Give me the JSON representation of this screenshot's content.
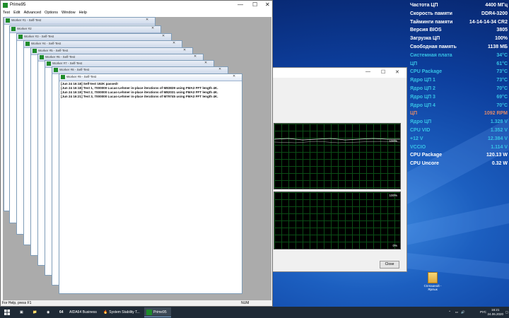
{
  "app": {
    "title": "Prime95",
    "menu": [
      "Test",
      "Edit",
      "Advanced",
      "Options",
      "Window",
      "Help"
    ],
    "status_text": "For Help, press F1",
    "num_indicator": "NUM"
  },
  "workers": [
    "Worker #1 - Self-Test",
    "Worker #2",
    "Worker #3 - Self-Test",
    "Worker #4 - Self-Test",
    "Worker #5 - Self-Test",
    "Worker #6 - Self-Test",
    "Worker #7 - Self-Test",
    "Worker #8 - Self-Test",
    "Worker #9 - Self-Test"
  ],
  "front_worker": {
    "title": "Worker #9 - Self-Test",
    "log": [
      "[Jun 24 16:18] Self-test 192K passed!",
      "[Jun 24 16:18] Test 1, 7000000 Lucas-Lehmer in-place iterations of M83839 using FMA3 FFT length 4K.",
      "[Jun 24 16:19] Test 2, 7000000 Lucas-Lehmer in-place iterations of M82031 using FMA3 FFT length 4K.",
      "[Jun 24 16:21] Test 3, 7000000 Lucas-Lehmer in-place iterations of M79745 using FMA3 FFT length 4K."
    ]
  },
  "stability": {
    "graph1_pct": "100%",
    "graph2_top": "100%",
    "graph2_bottom": "0%",
    "close_label": "Close"
  },
  "sensors": [
    {
      "label": "Частота ЦП",
      "value": "4400 МГц",
      "color": "#ffffff"
    },
    {
      "label": "Скорость памяти",
      "value": "DDR4-3200",
      "color": "#ffffff"
    },
    {
      "label": "Тайминги памяти",
      "value": "14-14-14-34 CR2",
      "color": "#ffffff"
    },
    {
      "label": "Версия BIOS",
      "value": "3805",
      "color": "#ffffff"
    },
    {
      "label": "Загрузка ЦП",
      "value": "100%",
      "color": "#ffffff"
    },
    {
      "label": "Свободная память",
      "value": "1138 МБ",
      "color": "#ffffff"
    },
    {
      "label": "Системная плата",
      "value": "34°C",
      "color": "#37c3e6"
    },
    {
      "label": "ЦП",
      "value": "61°C",
      "color": "#37c3e6"
    },
    {
      "label": "CPU Package",
      "value": "73°C",
      "color": "#37c3e6"
    },
    {
      "label": "Ядро ЦП 1",
      "value": "73°C",
      "color": "#37c3e6"
    },
    {
      "label": "Ядро ЦП 2",
      "value": "70°C",
      "color": "#37c3e6"
    },
    {
      "label": "Ядро ЦП 3",
      "value": "69°C",
      "color": "#37c3e6"
    },
    {
      "label": "Ядро ЦП 4",
      "value": "70°C",
      "color": "#37c3e6"
    },
    {
      "label": "ЦП",
      "value": "1092 RPM",
      "color": "#e08a6a"
    },
    {
      "label": "Ядро ЦП",
      "value": "1.328 V",
      "color": "#37c3e6"
    },
    {
      "label": "CPU VID",
      "value": "1.352 V",
      "color": "#37c3e6"
    },
    {
      "label": "+12 V",
      "value": "12.384 V",
      "color": "#37c3e6"
    },
    {
      "label": "VCCIO",
      "value": "1.114 V",
      "color": "#37c3e6"
    },
    {
      "label": "CPU Package",
      "value": "120.13 W",
      "color": "#ffffff"
    },
    {
      "label": "CPU Uncore",
      "value": "0.32 W",
      "color": "#ffffff"
    }
  ],
  "desktop_icon": {
    "label": "Сплошной - Ярлык"
  },
  "taskbar": {
    "items": [
      {
        "label": "AIDA64 Business",
        "icon": "aida64-icon"
      },
      {
        "label": "System Stability T...",
        "icon": "stability-icon"
      },
      {
        "label": "Prime95",
        "icon": "prime95-icon"
      }
    ],
    "lang": "РУС",
    "time": "16:21",
    "date": "24.06.2020"
  }
}
